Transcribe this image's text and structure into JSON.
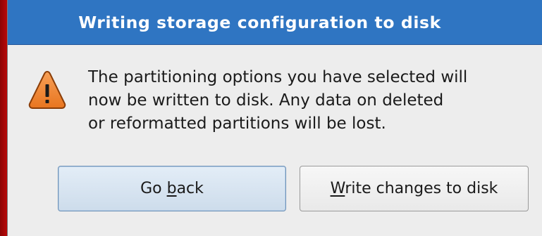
{
  "dialog": {
    "title": "Writing storage configuration to disk",
    "icon": "warning-triangle-icon",
    "message_lines": [
      "The partitioning options you have selected will",
      "now be written to disk.  Any data on deleted",
      "or reformatted partitions will be lost."
    ],
    "buttons": {
      "back": {
        "prefix": "Go ",
        "mnemonic": "b",
        "suffix": "ack"
      },
      "write": {
        "prefix": "",
        "mnemonic": "W",
        "suffix": "rite changes to disk"
      }
    }
  },
  "colors": {
    "title_bar": "#2f75c2",
    "background": "#cf0d0d",
    "dialog_body": "#ededed",
    "warning_fill": "#f28a3a"
  }
}
